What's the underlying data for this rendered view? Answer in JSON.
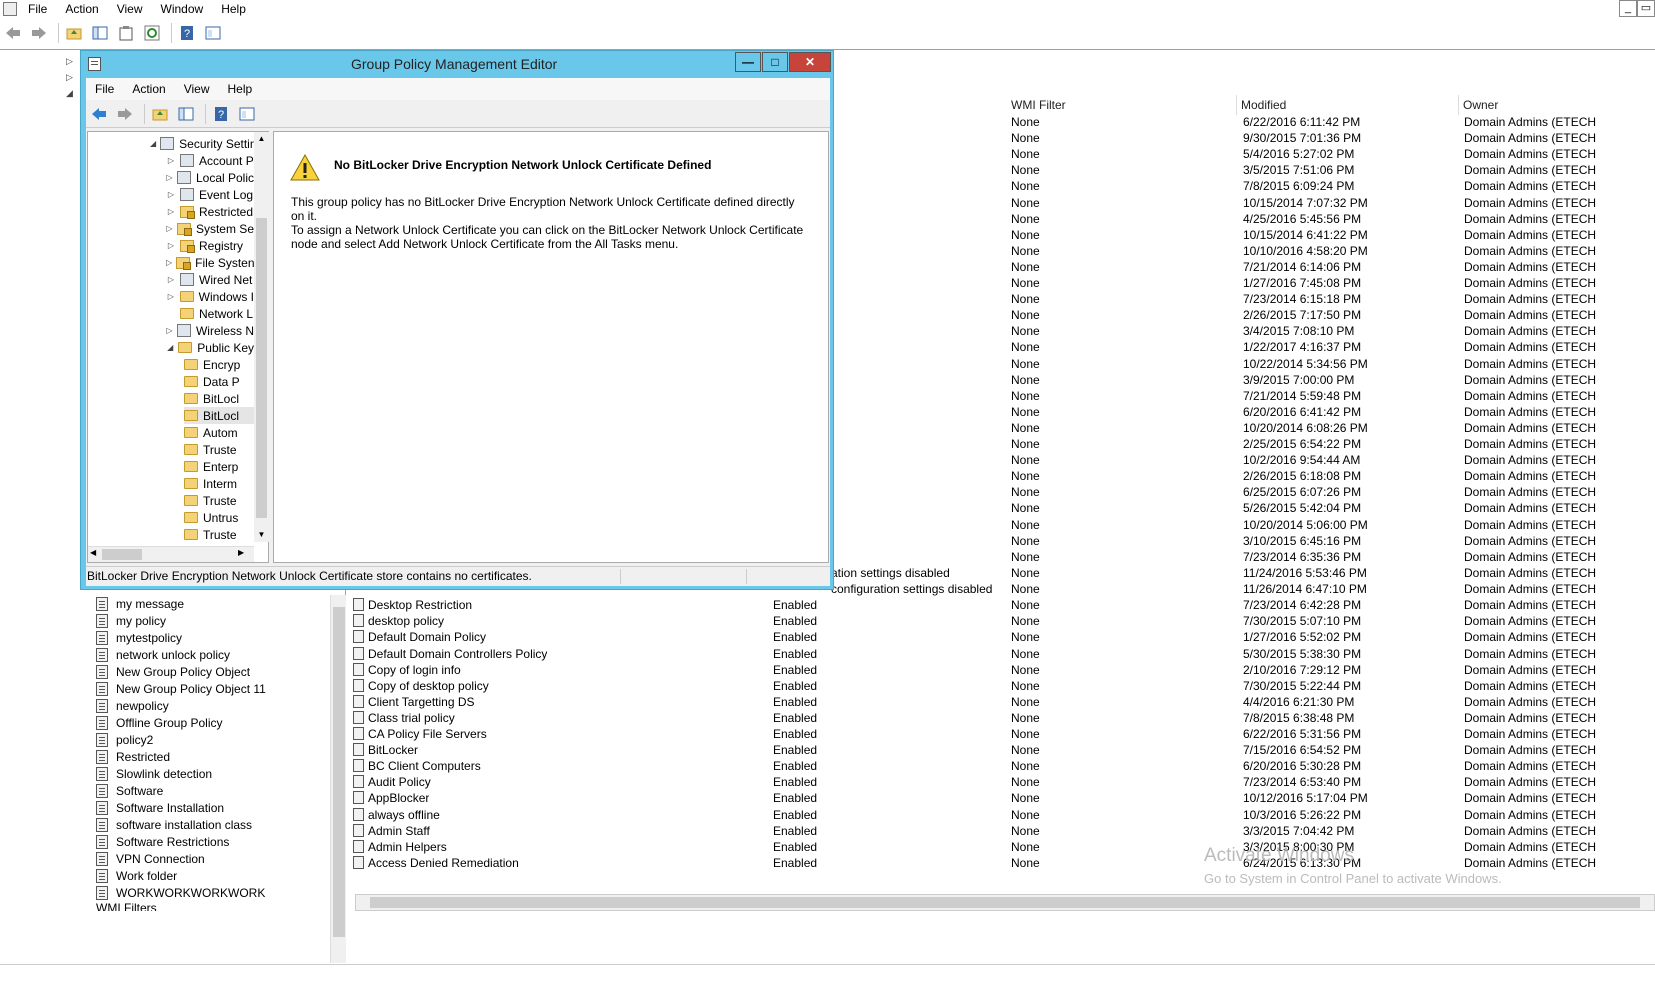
{
  "app": {
    "menu": [
      "File",
      "Action",
      "View",
      "Window",
      "Help"
    ],
    "win_min": "_",
    "win_restore": "▭"
  },
  "left_tree": {
    "items": [
      "my message",
      "my policy",
      "mytestpolicy",
      "network unlock policy",
      "New Group Policy Object",
      "New Group Policy Object 11",
      "newpolicy",
      "Offline Group Policy",
      "policy2",
      "Restricted",
      "Slowlink detection",
      "Software",
      "Software Installation",
      "software installation class",
      "Software Restrictions",
      "VPN Connection",
      "Work folder",
      "WORKWORKWORKWORK"
    ],
    "last_partial": "WMI Filters"
  },
  "list": {
    "columns": {
      "wmi": "WMI Filter",
      "modified": "Modified",
      "owner": "Owner"
    },
    "top_rows": [
      {
        "wmi": "None",
        "modified": "6/22/2016 6:11:42 PM",
        "owner": "Domain Admins (ETECH"
      },
      {
        "wmi": "None",
        "modified": "9/30/2015 7:01:36 PM",
        "owner": "Domain Admins (ETECH"
      },
      {
        "wmi": "None",
        "modified": "5/4/2016 5:27:02 PM",
        "owner": "Domain Admins (ETECH"
      },
      {
        "wmi": "None",
        "modified": "3/5/2015 7:51:06 PM",
        "owner": "Domain Admins (ETECH"
      },
      {
        "wmi": "None",
        "modified": "7/8/2015 6:09:24 PM",
        "owner": "Domain Admins (ETECH"
      },
      {
        "wmi": "None",
        "modified": "10/15/2014 7:07:32 PM",
        "owner": "Domain Admins (ETECH"
      },
      {
        "wmi": "None",
        "modified": "4/25/2016 5:45:56 PM",
        "owner": "Domain Admins (ETECH"
      },
      {
        "wmi": "None",
        "modified": "10/15/2014 6:41:22 PM",
        "owner": "Domain Admins (ETECH"
      },
      {
        "wmi": "None",
        "modified": "10/10/2016 4:58:20 PM",
        "owner": "Domain Admins (ETECH"
      },
      {
        "wmi": "None",
        "modified": "7/21/2014 6:14:06 PM",
        "owner": "Domain Admins (ETECH"
      },
      {
        "wmi": "None",
        "modified": "1/27/2016 7:45:08 PM",
        "owner": "Domain Admins (ETECH"
      },
      {
        "wmi": "None",
        "modified": "7/23/2014 6:15:18 PM",
        "owner": "Domain Admins (ETECH"
      },
      {
        "wmi": "None",
        "modified": "2/26/2015 7:17:50 PM",
        "owner": "Domain Admins (ETECH"
      },
      {
        "wmi": "None",
        "modified": "3/4/2015 7:08:10 PM",
        "owner": "Domain Admins (ETECH"
      },
      {
        "wmi": "None",
        "modified": "1/22/2017 4:16:37 PM",
        "owner": "Domain Admins (ETECH"
      },
      {
        "wmi": "None",
        "modified": "10/22/2014 5:34:56 PM",
        "owner": "Domain Admins (ETECH"
      },
      {
        "wmi": "None",
        "modified": "3/9/2015 7:00:00 PM",
        "owner": "Domain Admins (ETECH"
      },
      {
        "wmi": "None",
        "modified": "7/21/2014 5:59:48 PM",
        "owner": "Domain Admins (ETECH"
      },
      {
        "wmi": "None",
        "modified": "6/20/2016 6:41:42 PM",
        "owner": "Domain Admins (ETECH"
      },
      {
        "wmi": "None",
        "modified": "10/20/2014 6:08:26 PM",
        "owner": "Domain Admins (ETECH"
      },
      {
        "wmi": "None",
        "modified": "2/25/2015 6:54:22 PM",
        "owner": "Domain Admins (ETECH"
      },
      {
        "wmi": "None",
        "modified": "10/2/2016 9:54:44 AM",
        "owner": "Domain Admins (ETECH"
      },
      {
        "wmi": "None",
        "modified": "2/26/2015 6:18:08 PM",
        "owner": "Domain Admins (ETECH"
      },
      {
        "wmi": "None",
        "modified": "6/25/2015 6:07:26 PM",
        "owner": "Domain Admins (ETECH"
      },
      {
        "wmi": "None",
        "modified": "5/26/2015 5:42:04 PM",
        "owner": "Domain Admins (ETECH"
      },
      {
        "wmi": "None",
        "modified": "10/20/2014 5:06:00 PM",
        "owner": "Domain Admins (ETECH"
      },
      {
        "wmi": "None",
        "modified": "3/10/2015 6:45:16 PM",
        "owner": "Domain Admins (ETECH"
      },
      {
        "wmi": "None",
        "modified": "7/23/2014 6:35:36 PM",
        "owner": "Domain Admins (ETECH"
      }
    ],
    "rows": [
      {
        "name": "",
        "status": "ation settings disabled",
        "wmi": "None",
        "modified": "11/24/2016 5:53:46 PM",
        "owner": "Domain Admins (ETECH"
      },
      {
        "name": "",
        "status": "configuration settings disabled",
        "wmi": "None",
        "modified": "11/26/2014 6:47:10 PM",
        "owner": "Domain Admins (ETECH"
      },
      {
        "name": "Desktop Restriction",
        "status": "Enabled",
        "wmi": "None",
        "modified": "7/23/2014 6:42:28 PM",
        "owner": "Domain Admins (ETECH"
      },
      {
        "name": "desktop policy",
        "status": "Enabled",
        "wmi": "None",
        "modified": "7/30/2015 5:07:10 PM",
        "owner": "Domain Admins (ETECH"
      },
      {
        "name": "Default Domain Policy",
        "status": "Enabled",
        "wmi": "None",
        "modified": "1/27/2016 5:52:02 PM",
        "owner": "Domain Admins (ETECH"
      },
      {
        "name": "Default Domain Controllers Policy",
        "status": "Enabled",
        "wmi": "None",
        "modified": "5/30/2015 5:38:30 PM",
        "owner": "Domain Admins (ETECH"
      },
      {
        "name": "Copy of login info",
        "status": "Enabled",
        "wmi": "None",
        "modified": "2/10/2016 7:29:12 PM",
        "owner": "Domain Admins (ETECH"
      },
      {
        "name": "Copy of desktop policy",
        "status": "Enabled",
        "wmi": "None",
        "modified": "7/30/2015 5:22:44 PM",
        "owner": "Domain Admins (ETECH"
      },
      {
        "name": "Client Targetting DS",
        "status": "Enabled",
        "wmi": "None",
        "modified": "4/4/2016 6:21:30 PM",
        "owner": "Domain Admins (ETECH"
      },
      {
        "name": "Class trial policy",
        "status": "Enabled",
        "wmi": "None",
        "modified": "7/8/2015 6:38:48 PM",
        "owner": "Domain Admins (ETECH"
      },
      {
        "name": "CA Policy File Servers",
        "status": "Enabled",
        "wmi": "None",
        "modified": "6/22/2016 5:31:56 PM",
        "owner": "Domain Admins (ETECH"
      },
      {
        "name": "BitLocker",
        "status": "Enabled",
        "wmi": "None",
        "modified": "7/15/2016 6:54:52 PM",
        "owner": "Domain Admins (ETECH"
      },
      {
        "name": "BC Client Computers",
        "status": "Enabled",
        "wmi": "None",
        "modified": "6/20/2016 5:30:28 PM",
        "owner": "Domain Admins (ETECH"
      },
      {
        "name": "Audit Policy",
        "status": "Enabled",
        "wmi": "None",
        "modified": "7/23/2014 6:53:40 PM",
        "owner": "Domain Admins (ETECH"
      },
      {
        "name": "AppBlocker",
        "status": "Enabled",
        "wmi": "None",
        "modified": "10/12/2016 5:17:04 PM",
        "owner": "Domain Admins (ETECH"
      },
      {
        "name": "always offline",
        "status": "Enabled",
        "wmi": "None",
        "modified": "10/3/2016 5:26:22 PM",
        "owner": "Domain Admins (ETECH"
      },
      {
        "name": "Admin Staff",
        "status": "Enabled",
        "wmi": "None",
        "modified": "3/3/2015 7:04:42 PM",
        "owner": "Domain Admins (ETECH"
      },
      {
        "name": "Admin Helpers",
        "status": "Enabled",
        "wmi": "None",
        "modified": "3/3/2015 8:00:30 PM",
        "owner": "Domain Admins (ETECH"
      },
      {
        "name": "Access Denied Remediation",
        "status": "Enabled",
        "wmi": "None",
        "modified": "6/24/2015 6:13:30 PM",
        "owner": "Domain Admins (ETECH"
      }
    ]
  },
  "watermark": {
    "line1": "Activate Windows",
    "line2": "Go to System in Control Panel to activate Windows."
  },
  "dialog": {
    "title": "Group Policy Management Editor",
    "btn_min": "—",
    "btn_max": "□",
    "btn_close": "✕",
    "menu": [
      "File",
      "Action",
      "View",
      "Help"
    ],
    "tree": [
      {
        "label": "Security Settin",
        "level": 0,
        "expander": "◢",
        "icon": "poli"
      },
      {
        "label": "Account P",
        "level": 1,
        "expander": "▷",
        "icon": "poli"
      },
      {
        "label": "Local Polic",
        "level": 1,
        "expander": "▷",
        "icon": "poli"
      },
      {
        "label": "Event Log",
        "level": 1,
        "expander": "▷",
        "icon": "poli"
      },
      {
        "label": "Restricted",
        "level": 1,
        "expander": "▷",
        "icon": "lock"
      },
      {
        "label": "System Se",
        "level": 1,
        "expander": "▷",
        "icon": "lock"
      },
      {
        "label": "Registry",
        "level": 1,
        "expander": "▷",
        "icon": "lock"
      },
      {
        "label": "File Systen",
        "level": 1,
        "expander": "▷",
        "icon": "lock"
      },
      {
        "label": "Wired Net",
        "level": 1,
        "expander": "▷",
        "icon": "poli"
      },
      {
        "label": "Windows I",
        "level": 1,
        "expander": "▷",
        "icon": "folder"
      },
      {
        "label": "Network L",
        "level": 1,
        "expander": "",
        "icon": "folder"
      },
      {
        "label": "Wireless N",
        "level": 1,
        "expander": "▷",
        "icon": "poli"
      },
      {
        "label": "Public Key",
        "level": 1,
        "expander": "◢",
        "icon": "folder"
      },
      {
        "label": "Encryp",
        "level": 2,
        "expander": "",
        "icon": "folder"
      },
      {
        "label": "Data P",
        "level": 2,
        "expander": "",
        "icon": "folder"
      },
      {
        "label": "BitLocl",
        "level": 2,
        "expander": "",
        "icon": "folder"
      },
      {
        "label": "BitLocl",
        "level": 2,
        "expander": "",
        "icon": "folder",
        "selected": true
      },
      {
        "label": "Autom",
        "level": 2,
        "expander": "",
        "icon": "folder"
      },
      {
        "label": "Truste",
        "level": 2,
        "expander": "",
        "icon": "folder"
      },
      {
        "label": "Enterp",
        "level": 2,
        "expander": "",
        "icon": "folder"
      },
      {
        "label": "Interm",
        "level": 2,
        "expander": "",
        "icon": "folder"
      },
      {
        "label": "Truste",
        "level": 2,
        "expander": "",
        "icon": "folder"
      },
      {
        "label": "Untrus",
        "level": 2,
        "expander": "",
        "icon": "folder"
      },
      {
        "label": "Truste",
        "level": 2,
        "expander": "",
        "icon": "folder"
      }
    ],
    "warning_title": "No BitLocker Drive Encryption Network Unlock Certificate Defined",
    "warning_lines": [
      "This group policy has no BitLocker Drive Encryption Network Unlock Certificate defined directly on it.",
      "To assign a Network Unlock Certificate you can click on the BitLocker Network Unlock Certificate",
      "node and select Add Network Unlock Certificate from the All Tasks menu."
    ],
    "status": "BitLocker Drive Encryption Network Unlock Certificate store contains no certificates."
  }
}
